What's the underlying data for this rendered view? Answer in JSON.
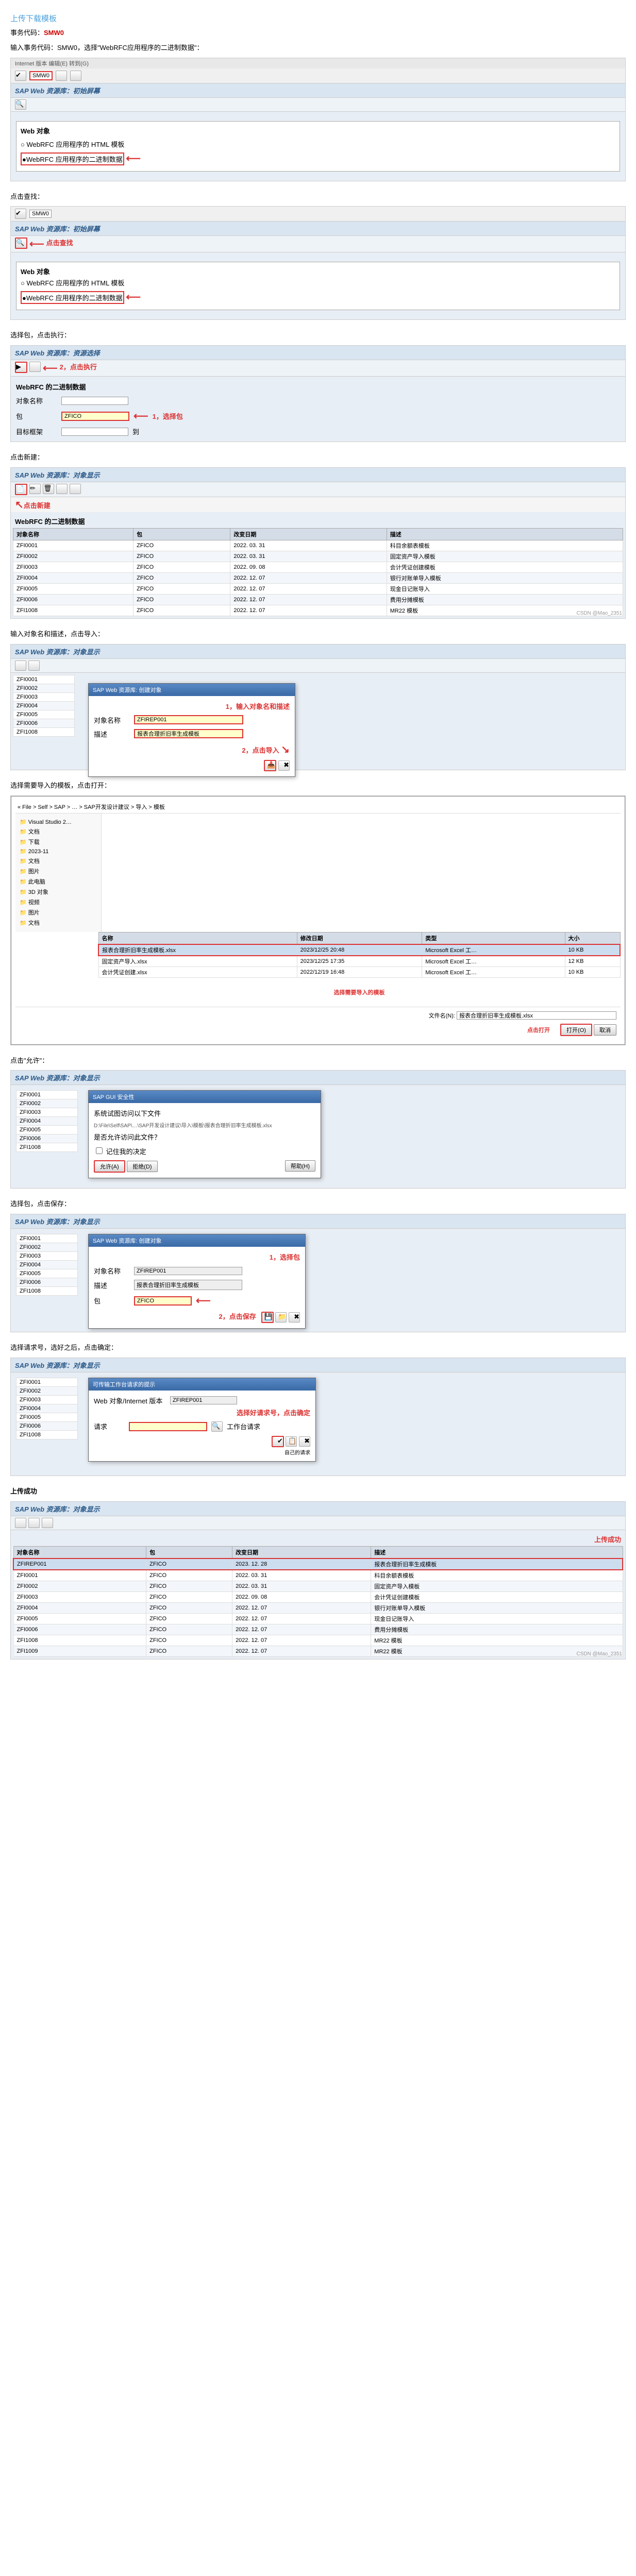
{
  "h_main": "上传下载模板",
  "h_tcode_label": "事务代码：",
  "tcode": "SMW0",
  "p_intro": "输入事务代码：SMW0，选择\"WebRFC应用程序的二进制数据\"：",
  "menu": "Internet 版本    编辑(E)    转到(G)",
  "tcode_val": "SMW0",
  "title1": "SAP Web  资源库：初始屏幕",
  "radio_grp": "Web 对象",
  "radio1": "WebRFC 应用程序的 HTML 模板",
  "radio2": "WebRFC 应用程序的二进制数据",
  "p_find": "点击查找：",
  "ann_find": "点击查找",
  "p_exec": "选择包，点击执行：",
  "title3": "SAP Web  资源库：资源选择",
  "ann_exec1": "1，选择包",
  "ann_exec2": "2，点击执行",
  "lbl_webrfc": "WebRFC 的二进制数据",
  "lbl_obj": "对象名称",
  "lbl_pkg": "包",
  "lbl_target": "目标框架",
  "pkg_val": "ZFICO",
  "target_val": "到",
  "p_new": "点击新建：",
  "title4": "SAP Web  资源库：对象显示",
  "ann_new": "点击新建",
  "th_obj": "对象名称",
  "th_pkg": "包",
  "th_date": "改变日期",
  "th_desc": "描述",
  "rows4": [
    {
      "o": "ZFI0001",
      "p": "ZFICO",
      "d": "2022. 03. 31",
      "s": "科目余额表模板"
    },
    {
      "o": "ZFI0002",
      "p": "ZFICO",
      "d": "2022. 03. 31",
      "s": "固定资产导入模板"
    },
    {
      "o": "ZFI0003",
      "p": "ZFICO",
      "d": "2022. 09. 08",
      "s": "会计凭证创建模板"
    },
    {
      "o": "ZFI0004",
      "p": "ZFICO",
      "d": "2022. 12. 07",
      "s": "银行对账单导入模板"
    },
    {
      "o": "ZFI0005",
      "p": "ZFICO",
      "d": "2022. 12. 07",
      "s": "现金日记账导入"
    },
    {
      "o": "ZFI0006",
      "p": "ZFICO",
      "d": "2022. 12. 07",
      "s": "费用分摊模板"
    },
    {
      "o": "ZFI1008",
      "p": "ZFICO",
      "d": "2022. 12. 07",
      "s": "MR22 模板"
    }
  ],
  "p_import": "输入对象名和描述，点击导入：",
  "ann_imp1": "1，输入对象名和描述",
  "ann_imp2": "2，点击导入",
  "dlg_title": "SAP Web 资源库: 创建对象",
  "lbl_oname": "对象名称",
  "lbl_odesc": "描述",
  "oname_val": "ZFIREP001",
  "odesc_val": "报表合理折旧率生成模板",
  "rows5": [
    {
      "o": "ZFI0001"
    },
    {
      "o": "ZFI0002"
    },
    {
      "o": "ZFI0003"
    },
    {
      "o": "ZFI0004"
    },
    {
      "o": "ZFI0005"
    },
    {
      "o": "ZFI0006"
    },
    {
      "o": "ZFI1008"
    }
  ],
  "p_open": "选择需要导入的模板，点击打开：",
  "ann_open1": "选择需要导入的模板",
  "ann_open2": "点击打开",
  "path_label": "« File > Self > SAP > … > SAP开发设计建议 > 导入 > 模板",
  "file_sel": "报表合理折旧率生成模板.xlsx",
  "files": [
    {
      "n": "报表合理折旧率生成模板.xlsx",
      "d": "2023/12/25 20:48",
      "t": "Microsoft Excel 工…",
      "s": "10 KB"
    },
    {
      "n": "固定资产导入.xlsx",
      "d": "2023/12/25 17:35",
      "t": "Microsoft Excel 工…",
      "s": "12 KB"
    },
    {
      "n": "会计凭证创建.xlsx",
      "d": "2022/12/19 16:48",
      "t": "Microsoft Excel 工…",
      "s": "10 KB"
    }
  ],
  "side": [
    "Visual Studio 2…",
    "文档",
    "下载",
    "2023-11",
    "文档",
    "图片",
    "此电脑",
    "3D 对象",
    "视频",
    "图片",
    "文档"
  ],
  "lbl_fname": "文件名(N):",
  "btn_open": "打开(O)",
  "btn_cancel": "取消",
  "p_allow": "点击\"允许\"：",
  "dlg_sec": "SAP GUI 安全性",
  "sec_msg1": "系统试图访问以下文件",
  "sec_path": "D:\\File\\Self\\SAP\\…\\SAP开发设计建议\\导入\\模板\\报表合理折旧率生成模板.xlsx",
  "sec_q": "是否允许访问此文件？",
  "sec_chk": "记住我的决定",
  "btn_allow": "允许(A)",
  "btn_deny": "拒绝(D)",
  "btn_help": "帮助(H)",
  "p_save": "选择包，点击保存：",
  "ann_save1": "1，选择包",
  "ann_save2": "2，点击保存",
  "dlg_save": "SAP Web 资源库: 创建对象",
  "pkg_lbl2": "包",
  "save_val": "ZFICO",
  "p_req": "选择请求号，选好之后，点击确定：",
  "ann_req": "选择好请求号，点击确定",
  "dlg_req": "可传输工作台请求的提示",
  "req_lbl": "Web 对象/Internet 版本",
  "req_val": "ZFIREP001",
  "req_lbl2": "请求",
  "req_num": "",
  "req_desc": "工作台请求",
  "req_own_lbl": "自己的请求",
  "p_done": "上传成功",
  "ann_done": "上传成功",
  "row_done": {
    "o": "ZFIREP001",
    "p": "ZFICO",
    "d": "2023. 12. 28",
    "s": "报表合理折旧率生成模板"
  },
  "rows_done": [
    {
      "o": "ZFI0001",
      "p": "ZFICO",
      "d": "2022. 03. 31",
      "s": "科目余额表模板"
    },
    {
      "o": "ZFI0002",
      "p": "ZFICO",
      "d": "2022. 03. 31",
      "s": "固定资产导入模板"
    },
    {
      "o": "ZFI0003",
      "p": "ZFICO",
      "d": "2022. 09. 08",
      "s": "会计凭证创建模板"
    },
    {
      "o": "ZFI0004",
      "p": "ZFICO",
      "d": "2022. 12. 07",
      "s": "银行对账单导入模板"
    },
    {
      "o": "ZFI0005",
      "p": "ZFICO",
      "d": "2022. 12. 07",
      "s": "现金日记账导入"
    },
    {
      "o": "ZFI0006",
      "p": "ZFICO",
      "d": "2022. 12. 07",
      "s": "费用分摊模板"
    },
    {
      "o": "ZFI1008",
      "p": "ZFICO",
      "d": "2022. 12. 07",
      "s": "MR22 模板"
    },
    {
      "o": "ZFI1009",
      "p": "ZFICO",
      "d": "2022. 12. 07",
      "s": "MR22 模板"
    }
  ],
  "wm": "CSDN @Mao_2351"
}
